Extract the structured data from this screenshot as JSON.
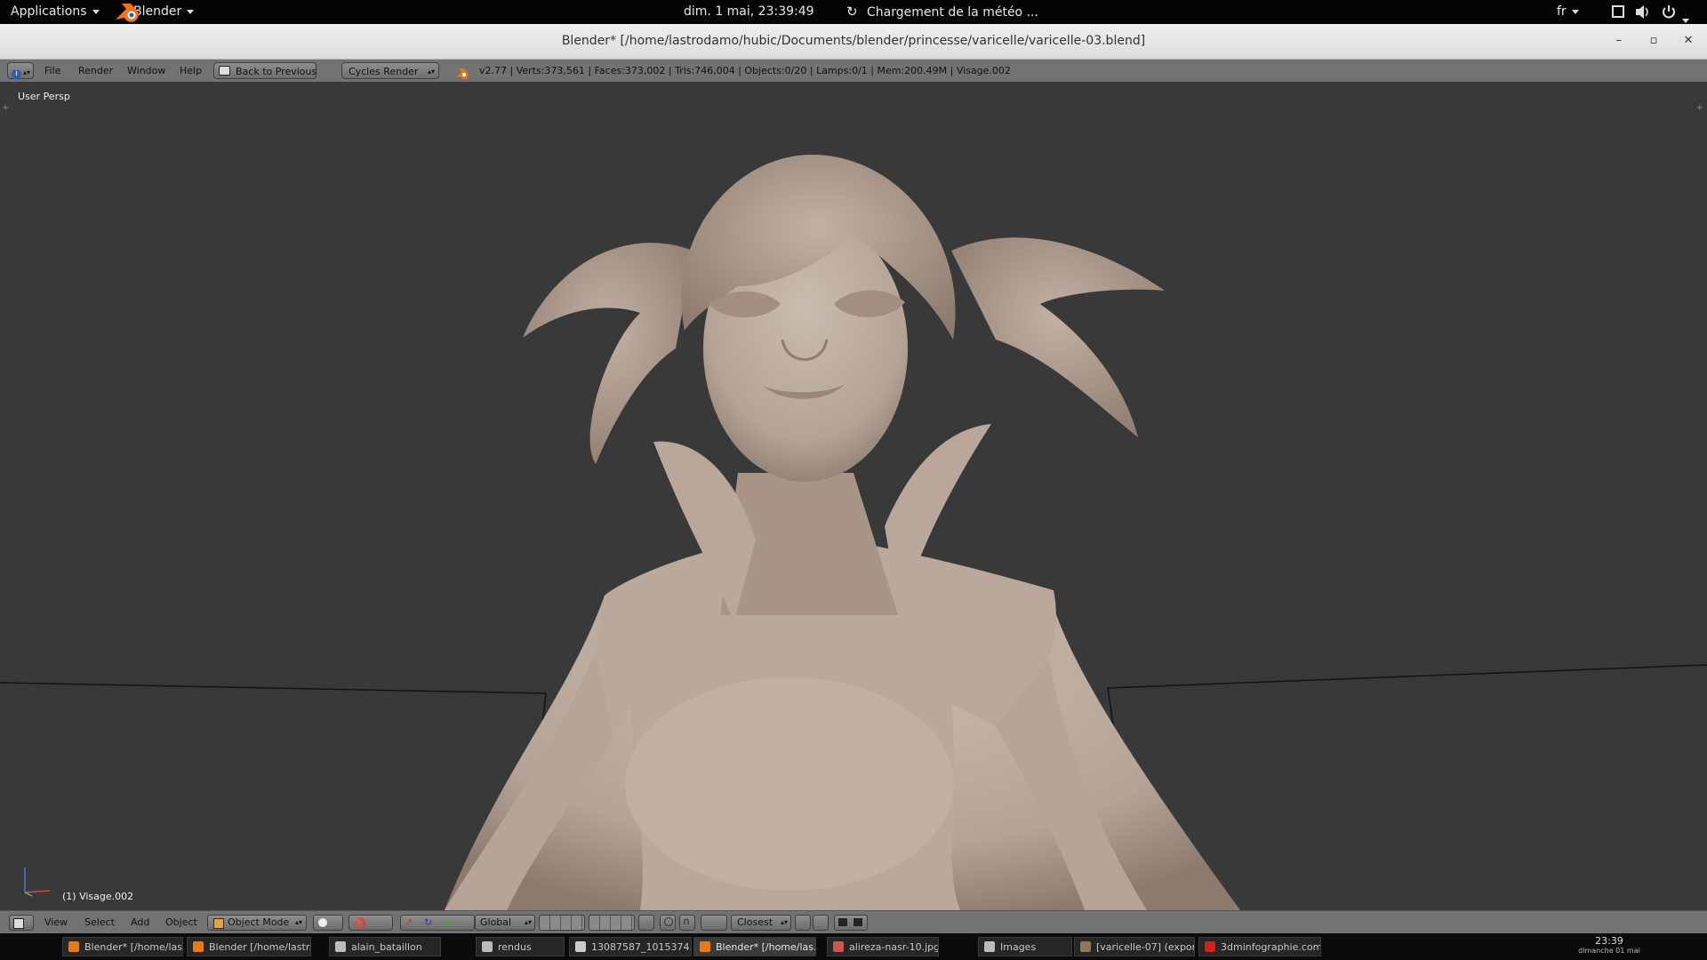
{
  "topbar": {
    "applications_label": "Applications",
    "app_label": "Blender",
    "datetime": "dim.  1 mai, 23:39:49",
    "weather": "Chargement de la météo ...",
    "language": "fr"
  },
  "window": {
    "title": "Blender* [/home/lastrodamo/hubic/Documents/blender/princesse/varicelle/varicelle-03.blend]"
  },
  "info_header": {
    "menus": [
      "File",
      "Render",
      "Window",
      "Help"
    ],
    "back_button": "Back to Previous",
    "render_engine": "Cycles Render",
    "stats": "v2.77 | Verts:373,561 | Faces:373,002 | Tris:746,004 | Objects:0/20 | Lamps:0/1 | Mem:200.49M | Visage.002"
  },
  "viewport": {
    "view_label": "User Persp",
    "object_label": "(1) Visage.002",
    "background_color": "#393939",
    "model_color": "#b5a598"
  },
  "view3d_header": {
    "menus": [
      "View",
      "Select",
      "Add",
      "Object"
    ],
    "mode": "Object Mode",
    "orientation": "Global",
    "snap_target": "Closest"
  },
  "taskbar": {
    "tasks": [
      {
        "label": "Blender* [/home/las...",
        "icon": "blender-icon",
        "active": false
      },
      {
        "label": "Blender [/home/lastr...",
        "icon": "blender-icon",
        "active": false
      },
      {
        "label": "alain_bataillon",
        "icon": "folder-icon",
        "active": false
      },
      {
        "label": "rendus",
        "icon": "folder-icon",
        "active": false
      },
      {
        "label": "13087587_1015374...",
        "icon": "image-icon",
        "active": false
      },
      {
        "label": "Blender* [/home/las...",
        "icon": "blender-icon",
        "active": true
      },
      {
        "label": "alireza-nasr-10.jpg",
        "icon": "image-icon",
        "active": false
      },
      {
        "label": "Images",
        "icon": "folder-icon",
        "active": false
      },
      {
        "label": "[varicelle-07] (expor...",
        "icon": "gimp-icon",
        "active": false
      },
      {
        "label": "3dminfographie.com...",
        "icon": "filezilla-icon",
        "active": false
      }
    ],
    "clock_time": "23:39",
    "clock_date": "dimanche 01 mai"
  }
}
